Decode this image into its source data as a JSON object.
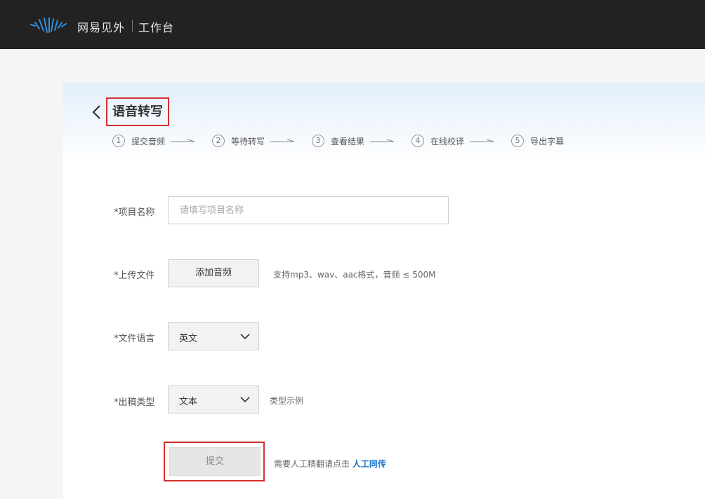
{
  "header": {
    "brand": "网易见外",
    "workspace": "工作台"
  },
  "page": {
    "title": "语音转写",
    "steps": [
      {
        "num": "1",
        "label": "提交音频"
      },
      {
        "num": "2",
        "label": "等待转写"
      },
      {
        "num": "3",
        "label": "查看结果"
      },
      {
        "num": "4",
        "label": "在线校译"
      },
      {
        "num": "5",
        "label": "导出字幕"
      }
    ]
  },
  "form": {
    "project_name": {
      "label": "*项目名称",
      "value": "",
      "placeholder": "请填写项目名称"
    },
    "upload": {
      "label": "*上传文件",
      "button": "添加音频",
      "hint": "支持mp3、wav、aac格式，音频 ≤ 500M"
    },
    "language": {
      "label": "*文件语言",
      "selected": "英文"
    },
    "output_type": {
      "label": "*出稿类型",
      "selected": "文本",
      "example_link": "类型示例"
    },
    "submit": {
      "label": "提交",
      "note": "需要人工精翻请点击",
      "link": "人工同传"
    }
  },
  "colors": {
    "topbar": "#222222",
    "logo_blue": "#2f8fe0",
    "highlight_red": "#d32f2f",
    "link_blue": "#1a73c9"
  },
  "icons": {
    "logo": "waveform-logo-icon",
    "back": "chevron-left-icon",
    "step_arrow": "arrow-right-icon",
    "dropdown": "chevron-down-icon"
  }
}
